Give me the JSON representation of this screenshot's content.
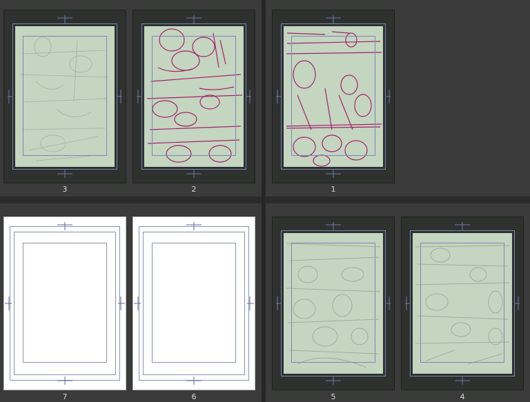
{
  "pages": [
    {
      "number": "3",
      "style": "light-sketch"
    },
    {
      "number": "2",
      "style": "red-sketch"
    },
    {
      "number": "1",
      "style": "red-sketch"
    },
    {
      "number": "7",
      "style": "blank"
    },
    {
      "number": "6",
      "style": "blank"
    },
    {
      "number": "5",
      "style": "light-sketch"
    },
    {
      "number": "4",
      "style": "light-sketch"
    }
  ],
  "colors": {
    "paper": "#c4d5c0",
    "red_sketch": "#a3236a",
    "gray_sketch": "#9aa89a",
    "guide": "#7b86b8"
  }
}
